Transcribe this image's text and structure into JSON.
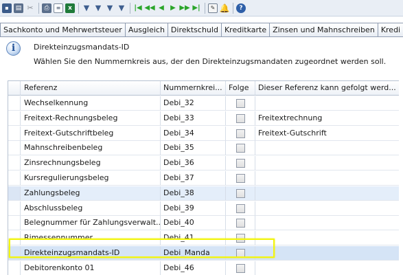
{
  "toolbar": {
    "icons": [
      "save-icon",
      "print-icon",
      "cut-icon",
      "print-preview-icon",
      "document-icon",
      "excel-export-icon",
      "filter-icon",
      "filter-add-icon",
      "filter-edit-icon",
      "filter-remove-icon",
      "first-record-icon",
      "previous-page-icon",
      "previous-record-icon",
      "next-record-icon",
      "next-page-icon",
      "last-record-icon",
      "note-icon",
      "alert-icon",
      "help-icon"
    ]
  },
  "tabs": [
    {
      "label": "Sachkonto und Mehrwertsteuer"
    },
    {
      "label": "Ausgleich"
    },
    {
      "label": "Direktschuld"
    },
    {
      "label": "Kreditkarte"
    },
    {
      "label": "Zinsen und Mahnschreiben"
    },
    {
      "label": "Kredi"
    }
  ],
  "info": {
    "title": "Direkteinzugsmandats-ID",
    "description": "Wählen Sie den Nummernkreis aus, der den Direkteinzugsmandaten zugeordnet werden soll."
  },
  "grid": {
    "columns": [
      "Referenz",
      "Nummernkrei...",
      "Folge",
      "Dieser Referenz kann gefolgt werd..."
    ],
    "rows": [
      {
        "ref": "Wechselkennung",
        "nr": "Debi_32",
        "folge": false,
        "next": ""
      },
      {
        "ref": "Freitext-Rechnungsbeleg",
        "nr": "Debi_33",
        "folge": false,
        "next": "Freitextrechnung"
      },
      {
        "ref": "Freitext-Gutschriftbeleg",
        "nr": "Debi_34",
        "folge": false,
        "next": "Freitext-Gutschrift"
      },
      {
        "ref": "Mahnschreibenbeleg",
        "nr": "Debi_35",
        "folge": false,
        "next": ""
      },
      {
        "ref": "Zinsrechnungsbeleg",
        "nr": "Debi_36",
        "folge": false,
        "next": ""
      },
      {
        "ref": "Kursregulierungsbeleg",
        "nr": "Debi_37",
        "folge": false,
        "next": ""
      },
      {
        "ref": "Zahlungsbeleg",
        "nr": "Debi_38",
        "folge": false,
        "next": ""
      },
      {
        "ref": "Abschlussbeleg",
        "nr": "Debi_39",
        "folge": false,
        "next": ""
      },
      {
        "ref": "Belegnummer für Zahlungsverwalt...",
        "nr": "Debi_40",
        "folge": false,
        "next": ""
      },
      {
        "ref": "Rimessennummer",
        "nr": "Debi_41",
        "folge": false,
        "next": ""
      },
      {
        "ref": "Direkteinzugsmandats-ID",
        "nr": "Debi_Manda",
        "folge": false,
        "next": ""
      },
      {
        "ref": "Debitorenkonto 01",
        "nr": "Debi_46",
        "folge": false,
        "next": ""
      }
    ]
  },
  "colors": {
    "highlight": "#f2f50e",
    "selected_row": "#d5e4f6",
    "tab_border": "#8e9bb0"
  }
}
